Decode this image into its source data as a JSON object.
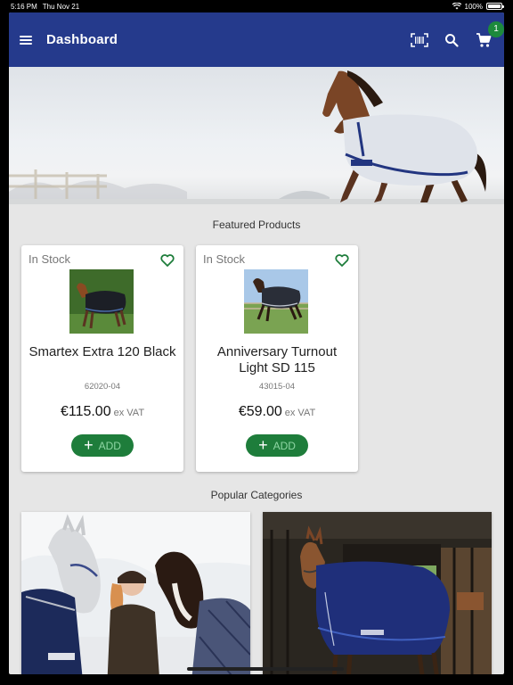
{
  "status_bar": {
    "time": "5:16 PM",
    "date": "Thu Nov 21",
    "battery": "100%"
  },
  "app_bar": {
    "title": "Dashboard",
    "cart_count": "1"
  },
  "featured": {
    "title": "Featured Products",
    "products": [
      {
        "stock": "In Stock",
        "name": "Smartex Extra 120 Black",
        "sku": "62020-04",
        "price": "€115.00",
        "vat": "ex VAT",
        "add_label": "ADD"
      },
      {
        "stock": "In Stock",
        "name": "Anniversary Turnout Light SD 115",
        "sku": "43015-04",
        "price": "€59.00",
        "vat": "ex VAT",
        "add_label": "ADD"
      }
    ]
  },
  "popular": {
    "title": "Popular Categories"
  },
  "colors": {
    "brand_blue": "#253a8c",
    "accent_green": "#1e7d3b"
  }
}
